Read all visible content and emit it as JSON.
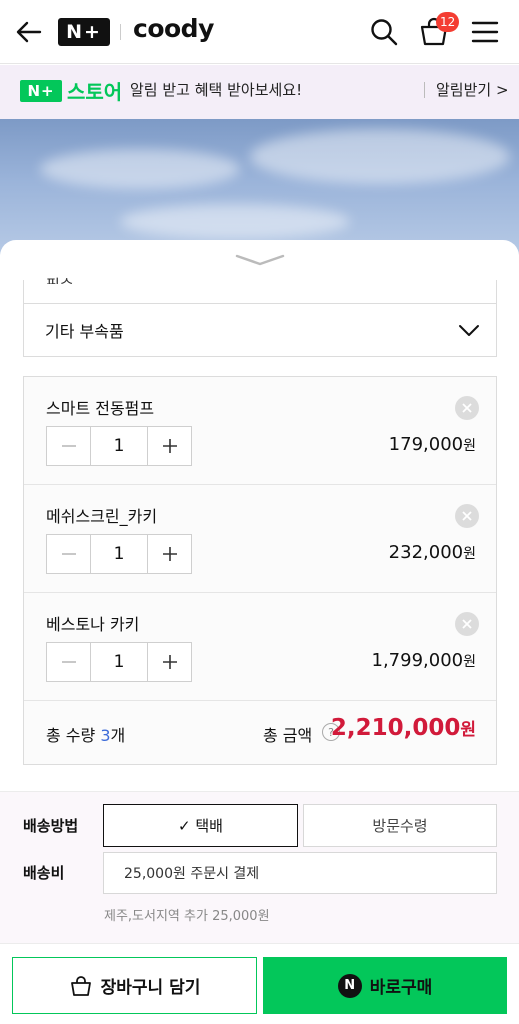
{
  "header": {
    "logo_np": "N+",
    "brand": "coody",
    "cart_count": "12"
  },
  "notice": {
    "badge": "N+",
    "store": "스토어",
    "text": "알림 받고 혜택 받아보세요!",
    "link": "알림받기 >"
  },
  "sheet": {
    "partial_label": "필수",
    "accordion_label": "기타 부속품",
    "items": [
      {
        "name": "스마트 전동펌프",
        "qty": "1",
        "price": "179,000",
        "won": "원"
      },
      {
        "name": "메쉬스크린_카키",
        "qty": "1",
        "price": "232,000",
        "won": "원"
      },
      {
        "name": "베스토나 카키",
        "qty": "1",
        "price": "1,799,000",
        "won": "원"
      }
    ],
    "total": {
      "qty_prefix": "총 수량 ",
      "qty_num": "3",
      "qty_suffix": "개",
      "label": "총 금액",
      "help": "?",
      "amount": "2,210,000",
      "won": "원"
    }
  },
  "shipping": {
    "method_label": "배송방법",
    "option_selected": "✓ 택배",
    "option_other": "방문수령",
    "fee_label": "배송비",
    "fee_value": "25,000원 주문시 결제",
    "fee_note": "제주,도서지역 추가 25,000원"
  },
  "actions": {
    "cart_label": "장바구니 담기",
    "buy_label": "바로구매",
    "buy_icon": "N"
  },
  "colors": {
    "naver_green": "#03c75a",
    "price_red": "#d11a3a",
    "qty_blue": "#3d6bd8",
    "badge_red": "#f43d32"
  }
}
